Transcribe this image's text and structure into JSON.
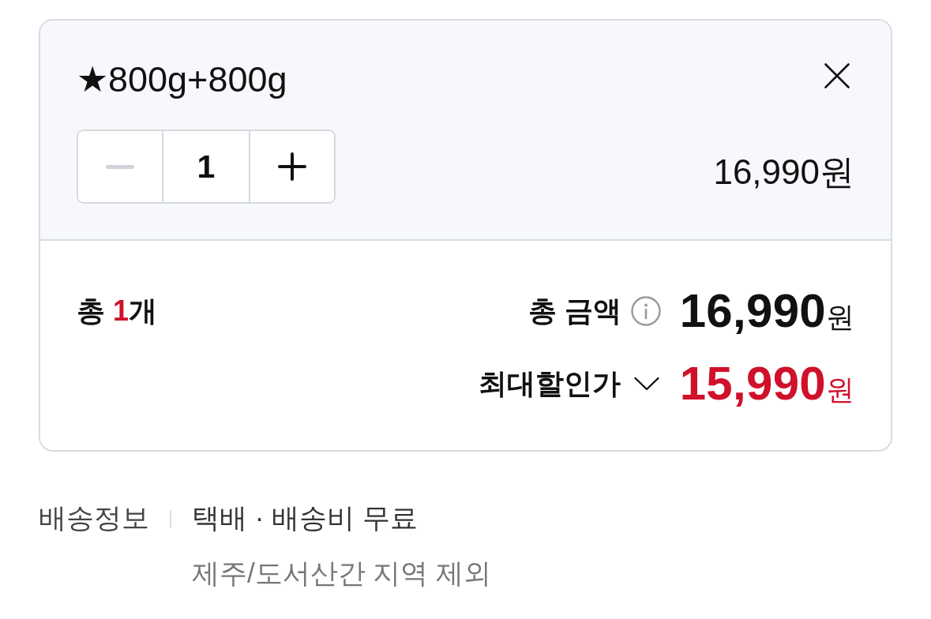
{
  "selected_option": {
    "name": "★800g+800g",
    "quantity": {
      "value": "1",
      "decrease_disabled": true
    },
    "price": "16,990원"
  },
  "summary": {
    "count": "총 **1**개",
    "total": {
      "label": "총 금액",
      "amount": "16,990",
      "unit": "원"
    },
    "discount": {
      "label": "최대할인가",
      "expanded": false,
      "amount": "15,990",
      "unit": "원"
    }
  },
  "shipping": {
    "label": "배송정보",
    "method": "택배 · 배송비 무료",
    "note": "제주/도서산간 지역 제외"
  }
}
